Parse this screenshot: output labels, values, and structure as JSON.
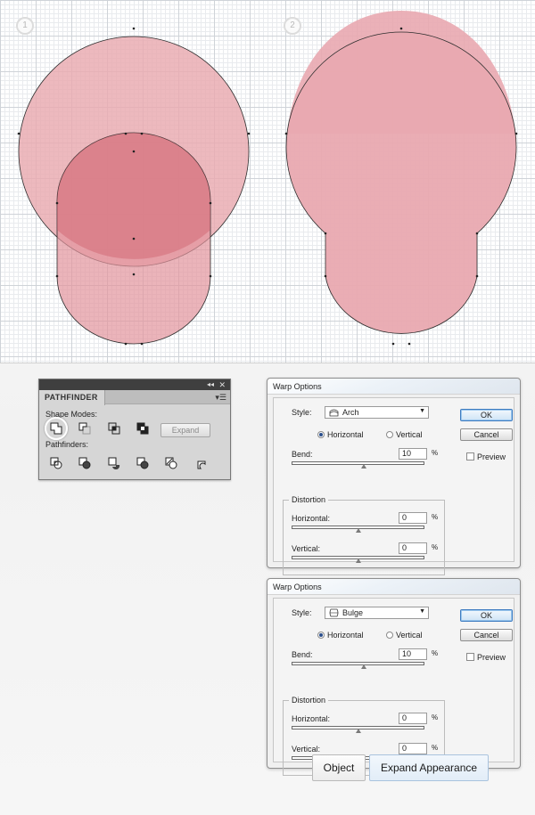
{
  "canvas": {
    "steps": [
      "1",
      "2"
    ]
  },
  "pathfinder": {
    "tab_title": "PATHFINDER",
    "collapse_glyph": "◂◂",
    "close_glyph": "✕",
    "menu_glyph": "▾☰",
    "shape_modes_label": "Shape Modes:",
    "pathfinders_label": "Pathfinders:",
    "expand_label": "Expand",
    "shape_mode_icons": [
      "unite-icon",
      "minus-front-icon",
      "intersect-icon",
      "exclude-icon"
    ],
    "pathfinder_icons": [
      "divide-icon",
      "trim-icon",
      "merge-icon",
      "crop-icon",
      "outline-icon",
      "minus-back-icon"
    ]
  },
  "warp_dialogs": [
    {
      "title": "Warp Options",
      "style_label": "Style:",
      "style_value": "Arch",
      "style_icon": "arch-icon",
      "horizontal_label": "Horizontal",
      "vertical_label": "Vertical",
      "orientation": "Horizontal",
      "bend_label": "Bend:",
      "bend_value": "10",
      "bend_unit": "%",
      "distortion_label": "Distortion",
      "dist_horizontal_label": "Horizontal:",
      "dist_horizontal_value": "0",
      "dist_vertical_label": "Vertical:",
      "dist_vertical_value": "0",
      "unit": "%",
      "ok_label": "OK",
      "cancel_label": "Cancel",
      "preview_label": "Preview"
    },
    {
      "title": "Warp Options",
      "style_label": "Style:",
      "style_value": "Bulge",
      "style_icon": "bulge-icon",
      "horizontal_label": "Horizontal",
      "vertical_label": "Vertical",
      "orientation": "Horizontal",
      "bend_label": "Bend:",
      "bend_value": "10",
      "bend_unit": "%",
      "distortion_label": "Distortion",
      "dist_horizontal_label": "Horizontal:",
      "dist_horizontal_value": "0",
      "dist_vertical_label": "Vertical:",
      "dist_vertical_value": "0",
      "unit": "%",
      "ok_label": "OK",
      "cancel_label": "Cancel",
      "preview_label": "Preview"
    }
  ],
  "object_bar": {
    "object_label": "Object",
    "expand_appearance_label": "Expand Appearance"
  },
  "colors": {
    "shape_fill": "#e9a9b0",
    "overlap_fill": "#d9717d",
    "shape_stroke": "#2d2d2d"
  }
}
